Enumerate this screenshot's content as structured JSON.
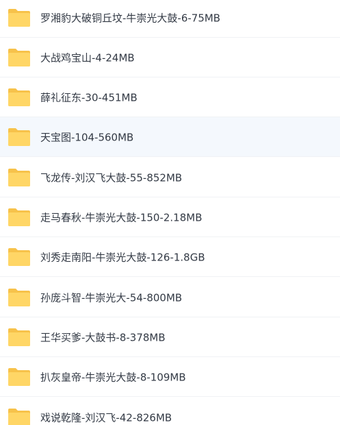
{
  "file_list": {
    "selected_index": 3,
    "items": [
      {
        "name": "罗湘豹大破铜丘坟-牛崇光大鼓-6-75MB",
        "icon": "folder-icon"
      },
      {
        "name": "大战鸡宝山-4-24MB",
        "icon": "folder-icon"
      },
      {
        "name": "薛礼征东-30-451MB",
        "icon": "folder-icon"
      },
      {
        "name": "天宝图-104-560MB",
        "icon": "folder-icon"
      },
      {
        "name": "飞龙传-刘汉飞大鼓-55-852MB",
        "icon": "folder-icon"
      },
      {
        "name": "走马春秋-牛崇光大鼓-150-2.18MB",
        "icon": "folder-icon"
      },
      {
        "name": "刘秀走南阳-牛崇光大鼓-126-1.8GB",
        "icon": "folder-icon"
      },
      {
        "name": "孙庞斗智-牛崇光大-54-800MB",
        "icon": "folder-icon"
      },
      {
        "name": "王华买爹-大鼓书-8-378MB",
        "icon": "folder-icon"
      },
      {
        "name": "扒灰皇帝-牛崇光大鼓-8-109MB",
        "icon": "folder-icon"
      },
      {
        "name": "戏说乾隆-刘汉飞-42-826MB",
        "icon": "folder-icon"
      }
    ]
  },
  "colors": {
    "folder_back": "#f7c24a",
    "folder_front": "#ffd666",
    "row_selected": "#f4f8fd",
    "row_border": "#f0f2f5",
    "text": "#333a45"
  }
}
